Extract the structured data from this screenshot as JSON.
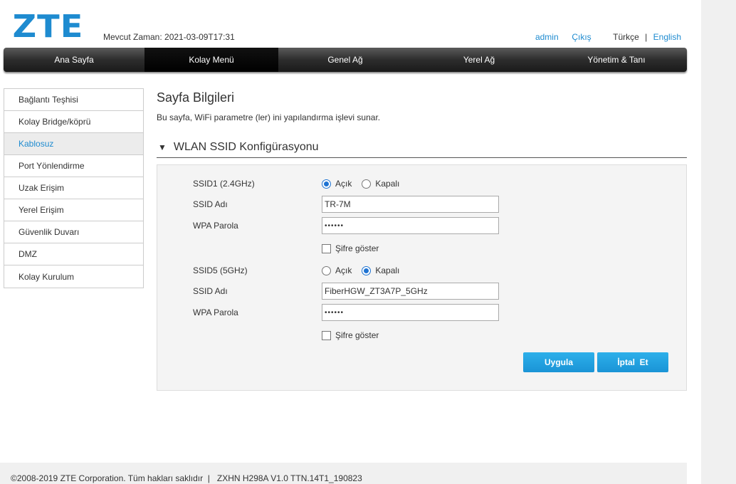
{
  "header": {
    "logo": "ZTE",
    "time_label": "Mevcut Zaman: 2021-03-09T17:31",
    "user": "admin",
    "logout": "Çıkış",
    "lang_tr": "Türkçe",
    "lang_sep": "|",
    "lang_en": "English"
  },
  "nav": {
    "items": [
      {
        "label": "Ana Sayfa"
      },
      {
        "label": "Kolay Menü"
      },
      {
        "label": "Genel Ağ"
      },
      {
        "label": "Yerel Ağ"
      },
      {
        "label": "Yönetim & Tanı"
      }
    ],
    "active_index": 1
  },
  "sidebar": {
    "items": [
      {
        "label": "Bağlantı Teşhisi"
      },
      {
        "label": "Kolay Bridge/köprü"
      },
      {
        "label": "Kablosuz"
      },
      {
        "label": "Port Yönlendirme"
      },
      {
        "label": "Uzak Erişim"
      },
      {
        "label": "Yerel Erişim"
      },
      {
        "label": "Güvenlik Duvarı"
      },
      {
        "label": "DMZ"
      },
      {
        "label": "Kolay Kurulum"
      }
    ],
    "active_index": 2
  },
  "page": {
    "title": "Sayfa Bilgileri",
    "description": "Bu sayfa, WiFi parametre (ler) ini yapılandırma işlevi sunar."
  },
  "section": {
    "toggle_icon": "▼",
    "title": "WLAN SSID Konfigürasyonu"
  },
  "ssid1": {
    "label": "SSID1 (2.4GHz)",
    "on_label": "Açık",
    "off_label": "Kapalı",
    "state": "on",
    "name_label": "SSID Adı",
    "name_value": "TR-7M",
    "pw_label": "WPA Parola",
    "pw_value": "••••••",
    "show_pw_label": "Şifre göster",
    "show_pw_checked": false
  },
  "ssid5": {
    "label": "SSID5 (5GHz)",
    "on_label": "Açık",
    "off_label": "Kapalı",
    "state": "off",
    "name_label": "SSID Adı",
    "name_value": "FiberHGW_ZT3A7P_5GHz",
    "pw_label": "WPA Parola",
    "pw_value": "••••••",
    "show_pw_label": "Şifre göster",
    "show_pw_checked": false
  },
  "buttons": {
    "apply": "Uygula",
    "cancel": "İptal  Et"
  },
  "footer": {
    "text": "©2008-2019 ZTE Corporation. Tüm hakları saklıdır  |   ZXHN H298A V1.0 TTN.14T1_190823"
  },
  "colors": {
    "accent": "#1e8bd0",
    "button": "#1a94d6",
    "nav_dark": "#2d2d2d"
  }
}
